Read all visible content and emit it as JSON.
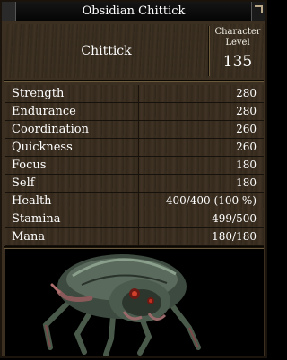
{
  "window": {
    "title": "Obsidian Chittick"
  },
  "header": {
    "name": "Chittick",
    "level_label_line1": "Character",
    "level_label_line2": "Level",
    "level_value": "135"
  },
  "stats": [
    {
      "label": "Strength",
      "value": "280"
    },
    {
      "label": "Endurance",
      "value": "280"
    },
    {
      "label": "Coordination",
      "value": "260"
    },
    {
      "label": "Quickness",
      "value": "260"
    },
    {
      "label": "Focus",
      "value": "180"
    },
    {
      "label": "Self",
      "value": "180"
    },
    {
      "label": "Health",
      "value": "400/400 (100 %)"
    },
    {
      "label": "Stamina",
      "value": "499/500"
    },
    {
      "label": "Mana",
      "value": "180/180"
    }
  ]
}
